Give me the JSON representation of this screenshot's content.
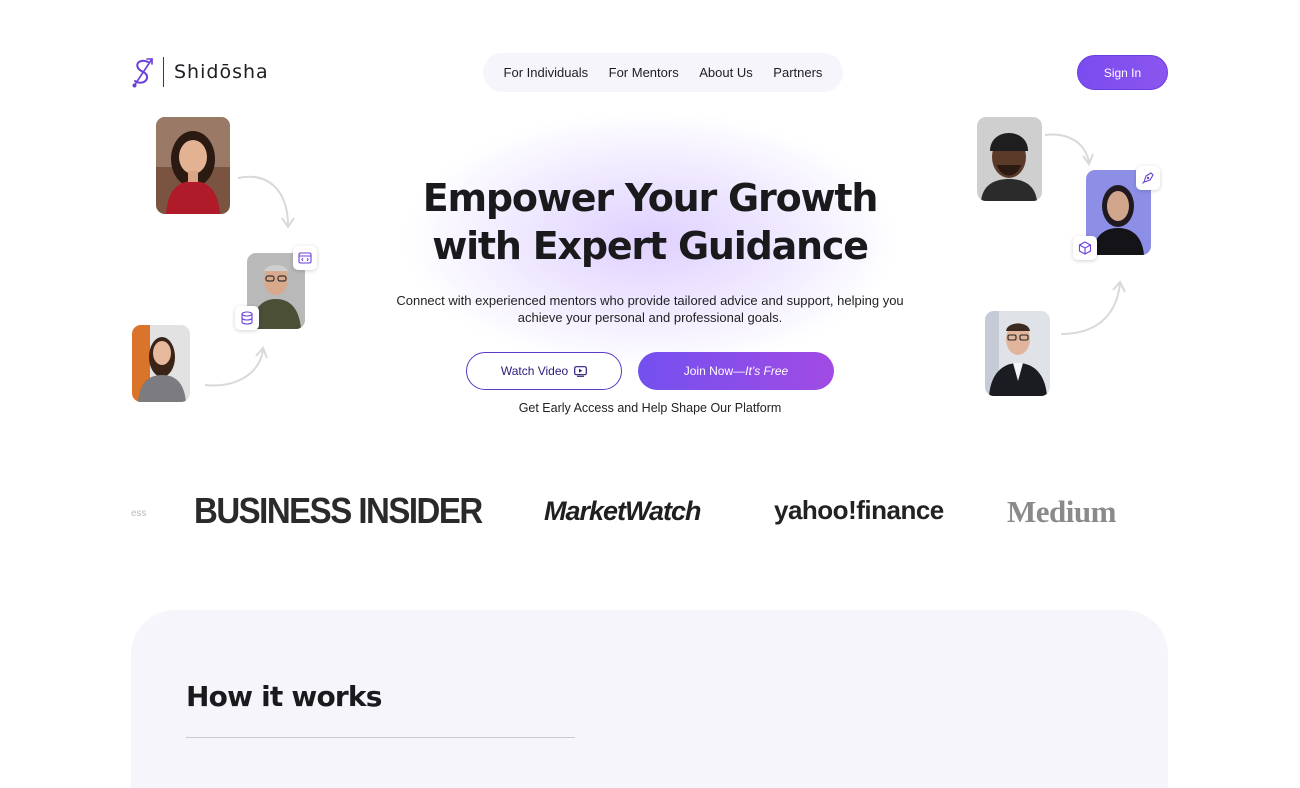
{
  "brand": {
    "name": "Shidōsha",
    "accent": "#7c4cf0"
  },
  "nav": {
    "items": [
      {
        "label": "For Individuals"
      },
      {
        "label": "For Mentors"
      },
      {
        "label": "About Us"
      },
      {
        "label": "Partners"
      }
    ]
  },
  "header": {
    "signin_label": "Sign In"
  },
  "hero": {
    "title_line1": "Empower Your Growth",
    "title_line2": "with Expert Guidance",
    "subtitle": "Connect with experienced mentors who provide tailored advice and support, helping you achieve your personal and professional goals.",
    "watch_label": "Watch Video",
    "join_label": "Join Now",
    "join_emphasis": "—It’s Free",
    "early_access": "Get Early Access and Help Shape Our Platform"
  },
  "press": {
    "logos": [
      {
        "name": "ess"
      },
      {
        "name": "BUSINESS INSIDER"
      },
      {
        "name": "MarketWatch"
      },
      {
        "name": "yahoo!finance"
      },
      {
        "name": "Medium"
      }
    ]
  },
  "how": {
    "title": "How it works"
  },
  "icons": {
    "play": "play-screen-icon",
    "code": "code-window-icon",
    "database": "database-icon",
    "pen": "pen-nib-icon",
    "cube": "cube-icon"
  }
}
